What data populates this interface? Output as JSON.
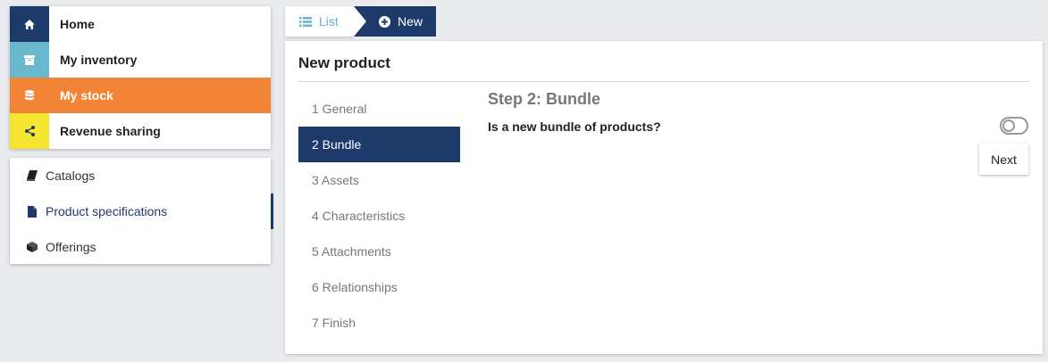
{
  "main_nav": {
    "items": [
      {
        "label": "Home",
        "icon": "home-icon",
        "color": "#1e3a6b"
      },
      {
        "label": "My inventory",
        "icon": "archive-icon",
        "color": "#6ab8cd"
      },
      {
        "label": "My stock",
        "icon": "database-icon",
        "color": "#f28535"
      },
      {
        "label": "Revenue sharing",
        "icon": "share-icon",
        "color": "#f5e52e"
      }
    ],
    "active": "My stock"
  },
  "sub_nav": {
    "items": [
      {
        "label": "Catalogs",
        "icon": "book-icon"
      },
      {
        "label": "Product specifications",
        "icon": "file-icon"
      },
      {
        "label": "Offerings",
        "icon": "cube-icon"
      }
    ],
    "active": "Product specifications"
  },
  "tabs": {
    "list_label": "List",
    "new_label": "New"
  },
  "panel": {
    "title": "New product",
    "steps": [
      "1 General",
      "2 Bundle",
      "3 Assets",
      "4 Characteristics",
      "5 Attachments",
      "6 Relationships",
      "7 Finish"
    ],
    "active_step": "2 Bundle",
    "step_title": "Step 2: Bundle",
    "question": "Is a new bundle of products?",
    "toggle_on": false,
    "next_label": "Next"
  },
  "colors": {
    "accent": "#1e3a6b",
    "stock_orange": "#f28535",
    "list_blue": "#6aaed0",
    "background": "#e9ebee"
  }
}
